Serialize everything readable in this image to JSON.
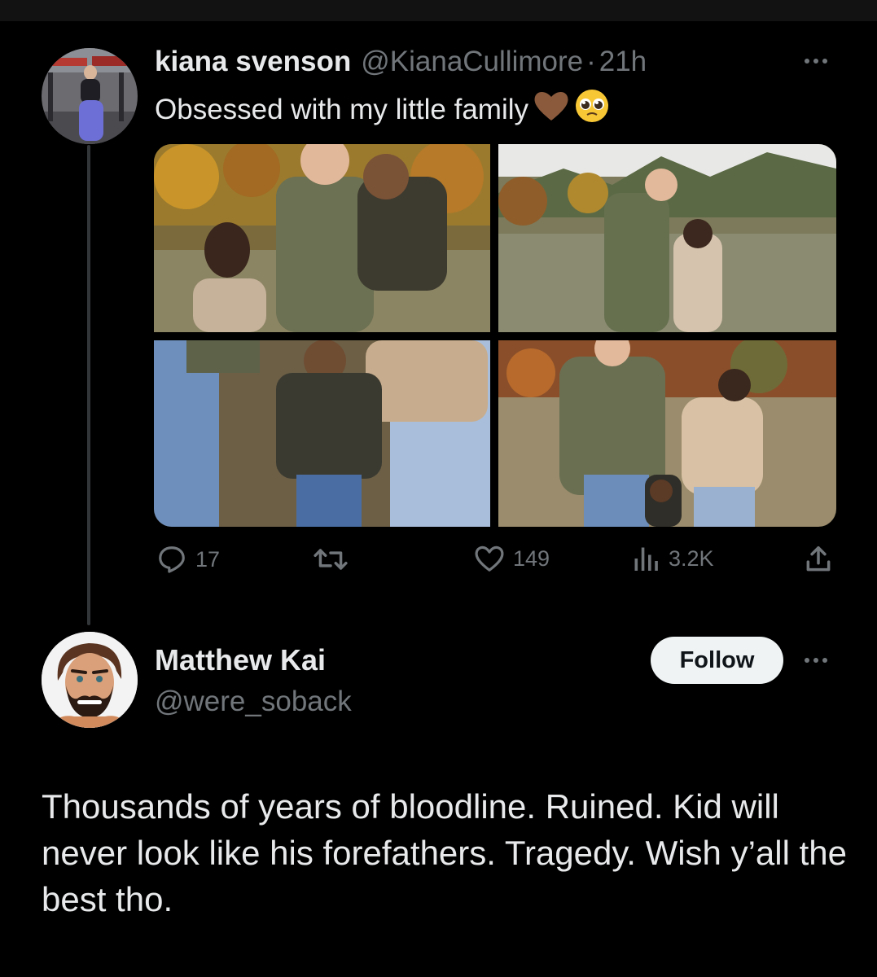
{
  "tweet": {
    "author_name": "kiana svenson",
    "author_handle": "@KianaCullimore",
    "separator": "·",
    "time": "21h",
    "text": "Obsessed with my little family",
    "emojis": [
      "brown-heart",
      "pleading-face"
    ],
    "stats": {
      "replies": "17",
      "retweets": "",
      "likes": "149",
      "views": "3.2K"
    }
  },
  "reply": {
    "author_name": "Matthew Kai",
    "author_handle": "@were_soback",
    "follow_label": "Follow",
    "text": "Thousands of years of bloodline. Ruined. Kid will never look like his forefathers. Tragedy. Wish y’all the best tho."
  },
  "colors": {
    "background": "#000000",
    "primary_text": "#e7e9ea",
    "secondary_text": "#71767b",
    "thread_line": "#333639",
    "follow_button_bg": "#eff3f4"
  }
}
